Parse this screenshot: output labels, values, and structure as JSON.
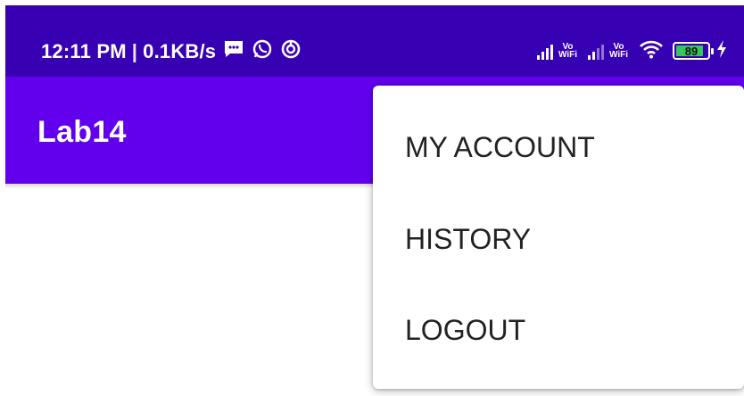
{
  "status_bar": {
    "time": "12:11 PM",
    "separator": "|",
    "net_speed": "0.1KB/s",
    "icons": [
      "message-icon",
      "whatsapp-icon",
      "data-saver-icon"
    ],
    "right_icons": [
      "signal-icon",
      "vowifi-icon",
      "signal-icon",
      "vowifi-icon",
      "wifi-icon",
      "battery-icon",
      "charging-icon"
    ],
    "vowifi_label_top": "Vo",
    "vowifi_label_bottom": "WiFi",
    "battery_level": "89",
    "battery_color": "#34c759"
  },
  "app_bar": {
    "title": "Lab14",
    "color": "#6200ee"
  },
  "menu": {
    "items": [
      {
        "label": "MY ACCOUNT"
      },
      {
        "label": "HISTORY"
      },
      {
        "label": "LOGOUT"
      }
    ]
  },
  "colors": {
    "status_bar": "#3700b3",
    "primary": "#6200ee",
    "menu_text": "#222222"
  }
}
